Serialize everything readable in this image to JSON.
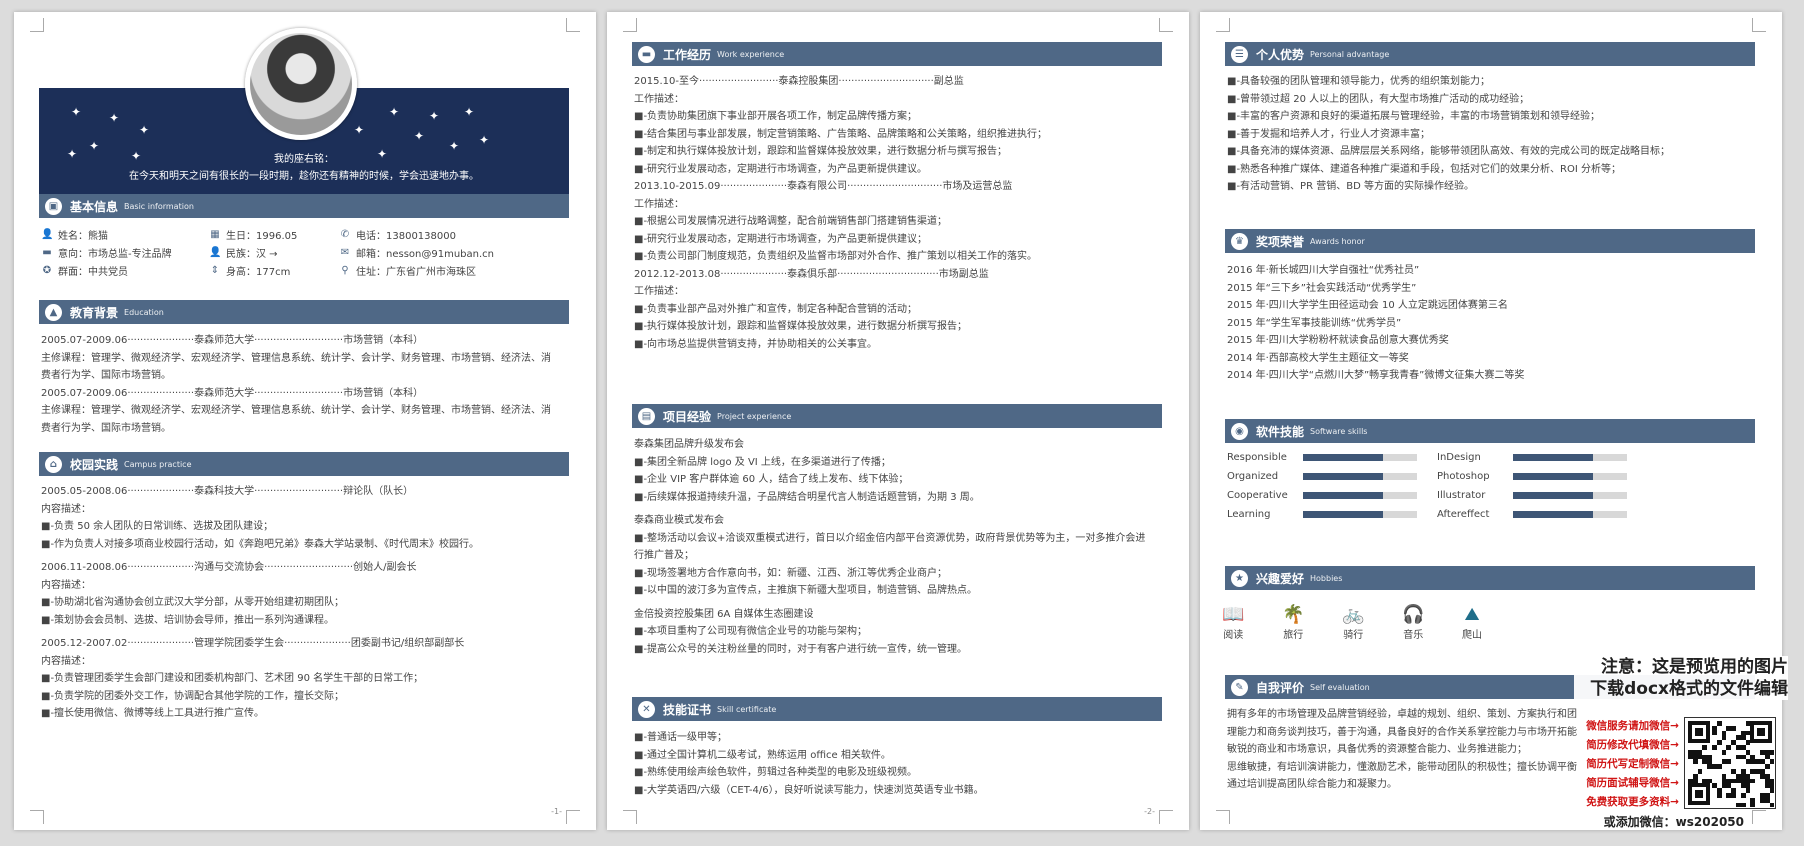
{
  "page1": {
    "motto_title": "我的座右铭：",
    "motto": "在今天和明天之间有很长的一段时期，趁你还有精神的时候，学会迅速地办事。",
    "page_number": "-1-",
    "basic": {
      "zh": "基本信息",
      "en": "Basic information",
      "items": [
        {
          "icon": "user-icon",
          "glyph": "👤",
          "text": "姓名：熊猫"
        },
        {
          "icon": "calendar-icon",
          "glyph": "▦",
          "text": "生日：1996.05"
        },
        {
          "icon": "phone-icon",
          "glyph": "✆",
          "text": "电话：13800138000"
        },
        {
          "icon": "briefcase-icon",
          "glyph": "▬",
          "text": "意向：市场总监-专注品牌"
        },
        {
          "icon": "people-icon",
          "glyph": "👤",
          "text": "民族：汉 →"
        },
        {
          "icon": "mail-icon",
          "glyph": "✉",
          "text": "邮箱：nesson@91muban.cn"
        },
        {
          "icon": "badge-icon",
          "glyph": "✪",
          "text": "群面：中共党员"
        },
        {
          "icon": "height-icon",
          "glyph": "⇕",
          "text": "身高：177cm"
        },
        {
          "icon": "location-icon",
          "glyph": "⚲",
          "text": "住址：广东省广州市海珠区"
        }
      ]
    },
    "education": {
      "zh": "教育背景",
      "en": "Education",
      "lines": [
        "2005.07-2009.06·····················泰森师范大学····························市场营销（本科）",
        "主修课程：管理学、微观经济学、宏观经济学、管理信息系统、统计学、会计学、财务管理、市场营销、经济法、消",
        "费者行为学、国际市场营销。",
        "2005.07-2009.06·····················泰森师范大学····························市场营销（本科）",
        "主修课程：管理学、微观经济学、宏观经济学、管理信息系统、统计学、会计学、财务管理、市场营销、经济法、消",
        "费者行为学、国际市场营销。"
      ]
    },
    "campus": {
      "zh": "校园实践",
      "en": "Campus practice",
      "lines": [
        "2005.05-2008.06·····················泰森科技大学····························辩论队（队长）",
        "内容描述：",
        "■-负责 50 余人团队的日常训练、选拔及团队建设；",
        "■-作为负责人对接多项商业校园行活动，如《奔跑吧兄弟》泰森大学站录制、《时代周末》校园行。",
        "",
        "2006.11-2008.06·····················沟通与交流协会····························创始人/副会长",
        "内容描述：",
        "■-协助湖北省沟通协会创立武汉大学分部，从零开始组建初期团队；",
        "■-策划协会会员制、选拔、培训协会导师，推出一系列沟通课程。",
        "",
        "2005.12-2007.02·····················管理学院团委学生会·····················团委副书记/组织部副部长",
        "内容描述：",
        "■-负责管理团委学生会部门建设和团委机构部门、艺术团 90 名学生干部的日常工作；",
        "■-负责学院的团委外交工作，协调配合其他学院的工作，擅长交际；",
        "■-擅长使用微信、微博等线上工具进行推广宣传。"
      ]
    }
  },
  "page2": {
    "page_number": "-2-",
    "work": {
      "zh": "工作经历",
      "en": "Work experience",
      "lines": [
        "2015.10-至今·························泰森控股集团······························副总监",
        "工作描述：",
        "■-负责协助集团旗下事业部开展各项工作，制定品牌传播方案；",
        "■-结合集团与事业部发展，制定营销策略、广告策略、品牌策略和公关策略，组织推进执行；",
        "■-制定和执行媒体投放计划，跟踪和监督媒体投放效果，进行数据分析与撰写报告；",
        "■-研究行业发展动态，定期进行市场调查，为产品更新提供建议。",
        "2013.10-2015.09·····················泰森有限公司······························市场及运营总监",
        "工作描述：",
        "■-根据公司发展情况进行战略调整，配合前端销售部门搭建销售渠道；",
        "■-研究行业发展动态，定期进行市场调查，为产品更新提供建议；",
        "■-负责公司部门制度规范，负责组织及监督市场部对外合作、推广策划以相关工作的落实。",
        "2012.12-2013.08·····················泰森俱乐部································市场副总监",
        "工作描述：",
        "■-负责事业部产品对外推广和宣传，制定各种配合营销的活动；",
        "■-执行媒体投放计划，跟踪和监督媒体投放效果，进行数据分析撰写报告；",
        "■-向市场总监提供营销支持，并协助相关的公关事宜。"
      ]
    },
    "project": {
      "zh": "项目经验",
      "en": "Project experience",
      "lines": [
        "泰森集团品牌升级发布会",
        "■-集团全新品牌 logo 及 VI 上线，在多渠道进行了传播；",
        "■-企业 VIP 客户群体逾 60 人，结合了线上发布、线下体验；",
        "■-后续媒体报道持续升温，子品牌结合明星代言人制造话题营销，为期 3 周。",
        "",
        "泰森商业模式发布会",
        "■-整场活动以会议+洽谈双重模式进行，首日以介绍金倍内部平台资源优势，政府背景优势等为主，一对多推介会进",
        "    行推广普及；",
        "■-现场签署地方合作意向书，如：新疆、江西、浙江等优秀企业商户；",
        "■-以中国的波汀多为宣传点，主推旗下新疆大型项目，制造营销、品牌热点。",
        "",
        "金倍投资控股集团 6A 自媒体生态圈建设",
        "■-本项目重构了公司现有微信企业号的功能与架构；",
        "■-提高公众号的关注粉丝量的同时，对于有客户进行统一宣传，统一管理。"
      ]
    },
    "cert": {
      "zh": "技能证书",
      "en": "Skill certificate",
      "lines": [
        "■-普通话一级甲等；",
        "■-通过全国计算机二级考试，熟练运用 office 相关软件。",
        "■-熟练使用绘声绘色软件，剪辑过各种类型的电影及班级视频。",
        "■-大学英语四/六级（CET-4/6），良好听说读写能力，快速浏览英语专业书籍。"
      ]
    }
  },
  "page3": {
    "advantage": {
      "zh": "个人优势",
      "en": "Personal advantage",
      "lines": [
        "■-具备较强的团队管理和领导能力，优秀的组织策划能力；",
        "■-曾带领过超 20 人以上的团队，有大型市场推广活动的成功经验；",
        "■-丰富的客户资源和良好的渠道拓展与管理经验，丰富的市场营销策划和领导经验；",
        "■-善于发掘和培养人才，行业人才资源丰富；",
        "■-具备充沛的媒体资源、品牌层层关系网络，能够带领团队高效、有效的完成公司的既定战略目标；",
        "■-熟悉各种推广媒体、建道各种推广渠道和手段，包括对它们的效果分析、ROI 分析等；",
        "■-有活动营销、PR 营销、BD 等方面的实际操作经验。"
      ]
    },
    "awards": {
      "zh": "奖项荣誉",
      "en": "Awards honor",
      "lines": [
        "2016 年·新长城四川大学自强社“优秀社员”",
        "2015 年“三下乡”社会实践活动“优秀学生”",
        "2015 年·四川大学学生田径运动会 10 人立定跳远团体赛第三名",
        "2015 年“学生军事技能训练“优秀学员”",
        "2015 年·四川大学粉粉杯就读食品创意大赛优秀奖",
        "2014 年·西部高校大学生主题征文一等奖",
        "2014 年·四川大学“点燃川大梦”畅享我青春”微博文征集大赛二等奖"
      ]
    },
    "software": {
      "zh": "软件技能",
      "en": "Software skills",
      "skills": [
        {
          "name": "Responsible",
          "level": 0.7
        },
        {
          "name": "InDesign",
          "level": 0.7
        },
        {
          "name": "Organized",
          "level": 0.7
        },
        {
          "name": "Photoshop",
          "level": 0.7
        },
        {
          "name": "Cooperative",
          "level": 0.7
        },
        {
          "name": "Illustrator",
          "level": 0.7
        },
        {
          "name": "Learning",
          "level": 0.7
        },
        {
          "name": "Aftereffect",
          "level": 0.7
        }
      ]
    },
    "hobbies": {
      "zh": "兴趣爱好",
      "en": "Hobbies",
      "items": [
        {
          "label": "阅读",
          "icon": "book-icon",
          "glyph": "📖"
        },
        {
          "label": "旅行",
          "icon": "palm-tree-icon",
          "glyph": "🌴"
        },
        {
          "label": "骑行",
          "icon": "bicycle-icon",
          "glyph": "🚲"
        },
        {
          "label": "音乐",
          "icon": "headphones-icon",
          "glyph": "🎧"
        },
        {
          "label": "爬山",
          "icon": "mountain-icon",
          "glyph": "⛰"
        }
      ]
    },
    "self": {
      "zh": "自我评价",
      "en": "Self evaluation",
      "lines": [
        "拥有多年的市场管理及品牌营销经验，卓越的规划、组织、策划、方案执行和团",
        "理能力和商务谈判技巧，善于沟通，具备良好的合作关系掌控能力与市场开拓能",
        "敏锐的商业和市场意识，具备优秀的资源整合能力、业务推进能力；",
        "思维敏捷，有培训演讲能力，懂激励艺术，能带动团队的积极性；擅长协调平衡",
        "通过培训提高团队综合能力和凝聚力。"
      ]
    }
  },
  "overlay": {
    "notice_line1": "注意：这是预览用的图片",
    "notice_line2": "下载docx格式的文件编辑",
    "links": [
      "微信服务请加微信→",
      "简历修改代填微信→",
      "简历代写定制微信→",
      "简历面试辅导微信→",
      "免费获取更多资料→"
    ],
    "wechat": "或添加微信：ws202050"
  }
}
